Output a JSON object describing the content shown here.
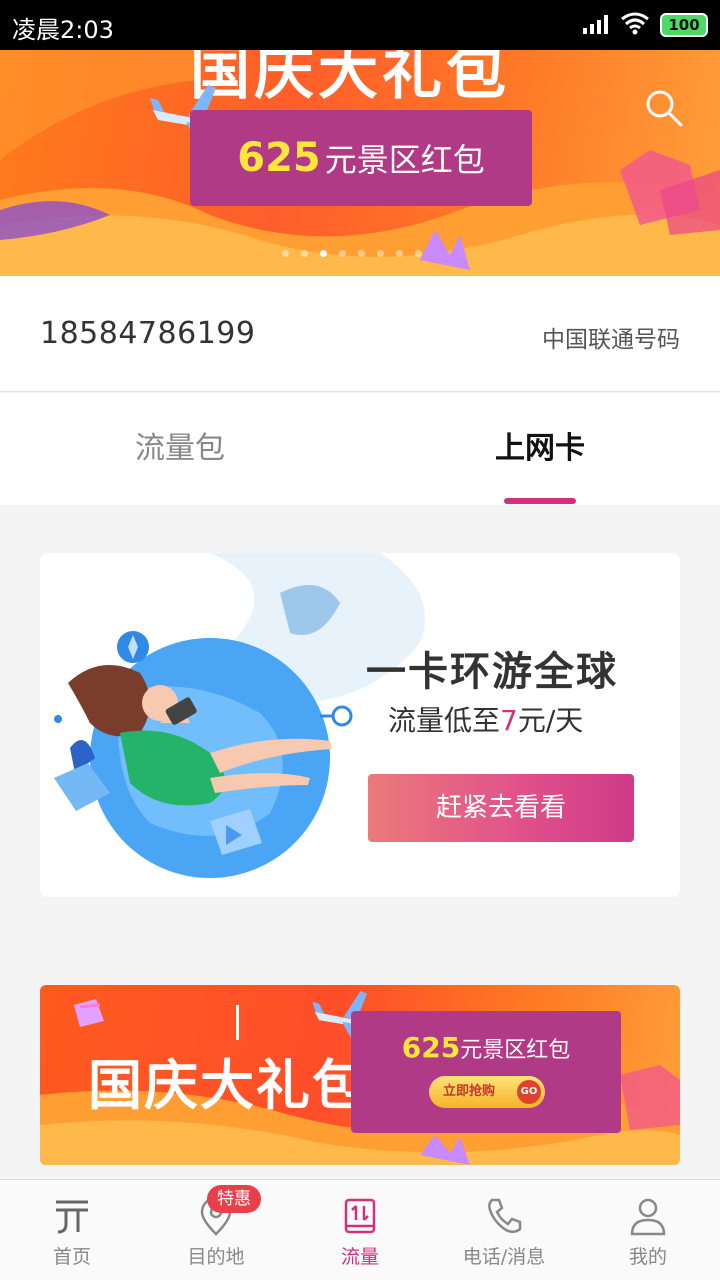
{
  "status_bar": {
    "time": "凌晨2:03",
    "battery": "100",
    "icons": [
      "signal-icon",
      "wifi-icon",
      "battery-icon"
    ]
  },
  "top_banner": {
    "title": "国庆大礼包",
    "promo_amount": "625",
    "promo_text": "元景区红包",
    "carousel_total": 8,
    "carousel_active_index": 2,
    "icons": [
      "search-icon",
      "airplane-icon"
    ]
  },
  "account": {
    "phone_number": "18584786199",
    "carrier_label": "中国联通号码"
  },
  "tabs": [
    {
      "label": "流量包",
      "active": false
    },
    {
      "label": "上网卡",
      "active": true
    }
  ],
  "promo_card": {
    "headline": "一卡环游全球",
    "sub_prefix": "流量低至",
    "sub_highlight": "7",
    "sub_suffix": "元/天",
    "cta_label": "赶紧去看看"
  },
  "bottom_banner": {
    "title": "国庆大礼包",
    "promo_amount": "625",
    "promo_text": "元景区红包",
    "buy_label": "立即抢购",
    "go_label": "GO"
  },
  "bottom_nav": [
    {
      "label": "首页",
      "icon": "home-icon",
      "active": false
    },
    {
      "label": "目的地",
      "icon": "location-pin-icon",
      "active": false,
      "badge": "特惠"
    },
    {
      "label": "流量",
      "icon": "data-traffic-icon",
      "active": true
    },
    {
      "label": "电话/消息",
      "icon": "phone-icon",
      "active": false
    },
    {
      "label": "我的",
      "icon": "profile-icon",
      "active": false
    }
  ],
  "colors": {
    "accent": "#d2307e",
    "promo_purple": "#b13a86",
    "banner_orange": "#ff6a24",
    "badge_red": "#e8404a",
    "promo_yellow": "#ffe63a"
  }
}
